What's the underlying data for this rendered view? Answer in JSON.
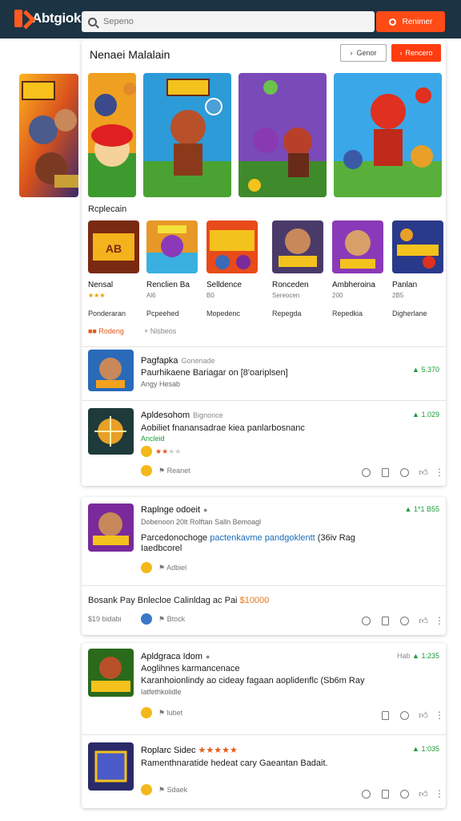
{
  "header": {
    "logo_text": "Abtgiok",
    "search_placeholder": "Sepeno",
    "search_button": "Renimer"
  },
  "featured": {
    "title": "Nenaei Malalain",
    "button_outline": "Genor",
    "button_solid": "Rencero"
  },
  "tiles_section": {
    "label": "Rcplecain",
    "tiles": [
      {
        "name": "Nensal",
        "rating": "★★★",
        "meta": "Ponderaran"
      },
      {
        "name": "Renclien Ba",
        "rating": "Al6",
        "meta": "Pcpeehed"
      },
      {
        "name": "Selldence",
        "rating": "B0",
        "meta": "Mopedenc"
      },
      {
        "name": "Ronceden",
        "rating": "Sereocen",
        "meta": "Repegda"
      },
      {
        "name": "Ambheroina",
        "rating": "200",
        "meta": "Repedkia"
      },
      {
        "name": "Panlan",
        "rating": "2B5",
        "meta": "Digherlane"
      }
    ],
    "badge": "Rodeng",
    "link": "Nisbeos"
  },
  "list": [
    {
      "title": "Pagfapka",
      "sub": "Gonenade",
      "desc": "Paurhikaene Bariagar on [8'oariplsen]",
      "small": "Angy Hesab",
      "green": "5.370"
    },
    {
      "title": "Apldesohom",
      "sub": "Bignonce",
      "desc": "Aobiliet fnanansadrae kiea panlarbosnanc",
      "small": "Ancleid",
      "green": "1.029",
      "rating": "★★",
      "link": "Reanet"
    }
  ],
  "card2": {
    "title": "Raplnge odoeit",
    "meta": "Dobenoon 20lt Rolftan Salln Bemoagl",
    "green": "1*1 B55",
    "desc_a": "Parcedonochoge",
    "desc_b": "pactenkavme pandgoklentt",
    "desc_c": "(36iv Rag",
    "desc2": "Iaedbcorel",
    "link": "Adbiel",
    "ticker_a": "Bosank Pay Bnlecloe Calinldag ac Pai",
    "ticker_b": "$10000",
    "ticker_meta": "$19 bidabi",
    "ticker_link": "Btock"
  },
  "card3": [
    {
      "title": "Apldgraca Idom",
      "line1": "Aoglihnes karmancenace",
      "line2": "Karanhoionlindy ao cideay fagaan aoplidenflc (Sb6m Ray",
      "line3": "Iatfethkolidle",
      "green": "1:235",
      "green_label": "Hab",
      "link": "lubet"
    },
    {
      "title": "Roplarc Sidec",
      "stars": "★★★★★",
      "line1": "Ramenthnaratide hedeat cary Gaeantan Badait.",
      "green": "1:035",
      "link": "Sdaek"
    }
  ],
  "colors": {
    "accent": "#ff4b16",
    "header": "#1c3344",
    "green": "#1a9b38"
  }
}
